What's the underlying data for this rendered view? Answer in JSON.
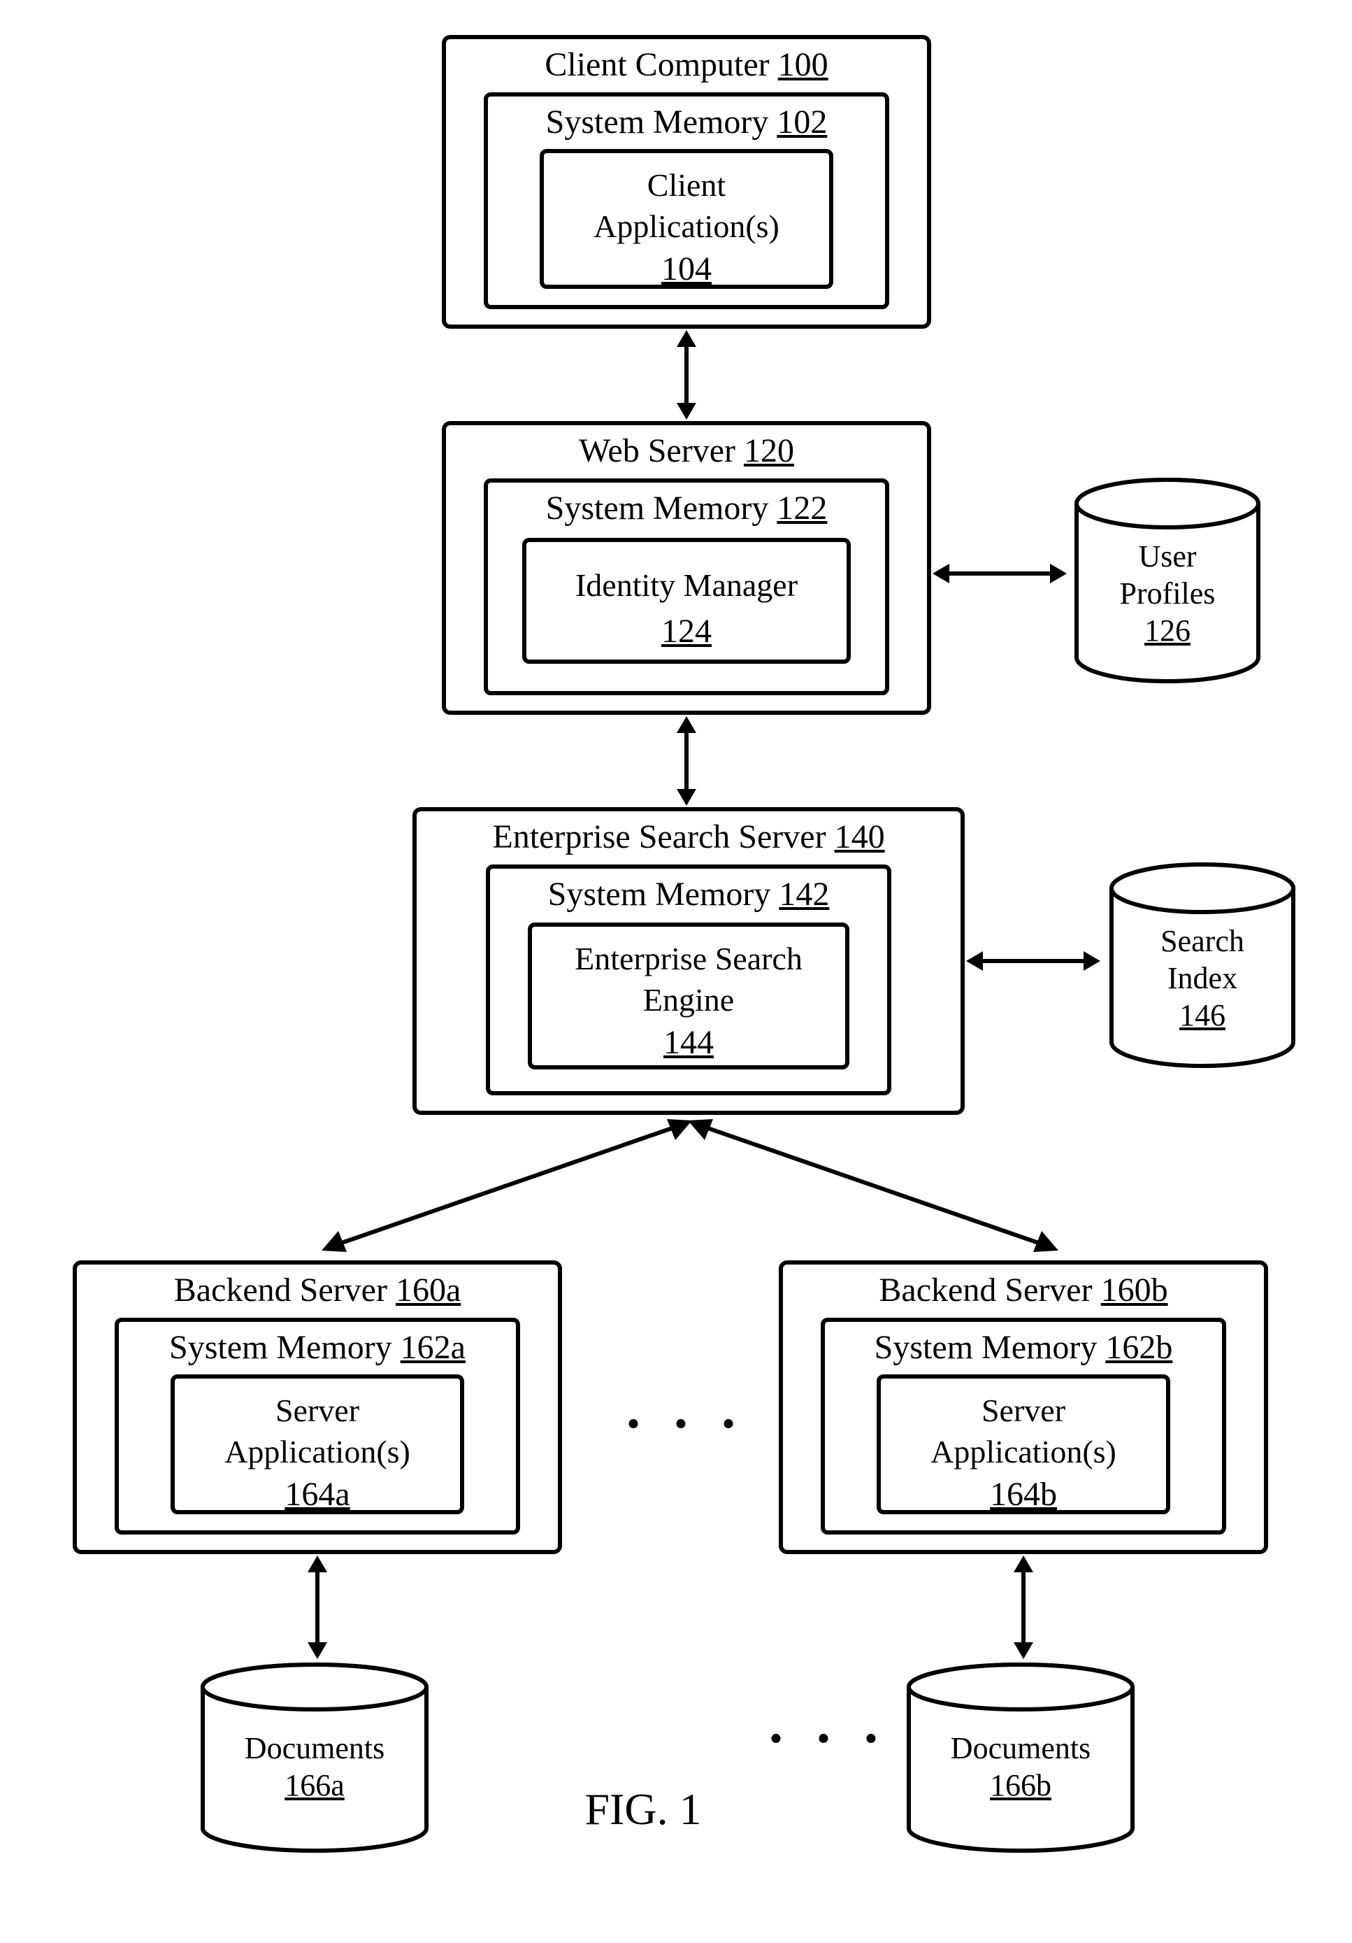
{
  "figure_label": "FIG. 1",
  "client": {
    "title": "Client Computer",
    "ref": "100",
    "mem_title": "System Memory",
    "mem_ref": "102",
    "app_title": "Client Application(s)",
    "app_ref": "104"
  },
  "web": {
    "title": "Web Server",
    "ref": "120",
    "mem_title": "System Memory",
    "mem_ref": "122",
    "app_title": "Identity Manager",
    "app_ref": "124"
  },
  "web_db": {
    "title": "User Profiles",
    "ref": "126"
  },
  "search": {
    "title": "Enterprise Search Server",
    "ref": "140",
    "mem_title": "System Memory",
    "mem_ref": "142",
    "app_title": "Enterprise Search Engine",
    "app_ref": "144"
  },
  "search_db": {
    "title": "Search Index",
    "ref": "146"
  },
  "backend_a": {
    "title": "Backend Server",
    "ref": "160a",
    "mem_title": "System Memory",
    "mem_ref": "162a",
    "app_title": "Server Application(s)",
    "app_ref": "164a"
  },
  "backend_a_db": {
    "title": "Documents",
    "ref": "166a"
  },
  "backend_b": {
    "title": "Backend Server",
    "ref": "160b",
    "mem_title": "System Memory",
    "mem_ref": "162b",
    "app_title": "Server Application(s)",
    "app_ref": "164b"
  },
  "backend_b_db": {
    "title": "Documents",
    "ref": "166b"
  },
  "ellipsis": ". . ."
}
